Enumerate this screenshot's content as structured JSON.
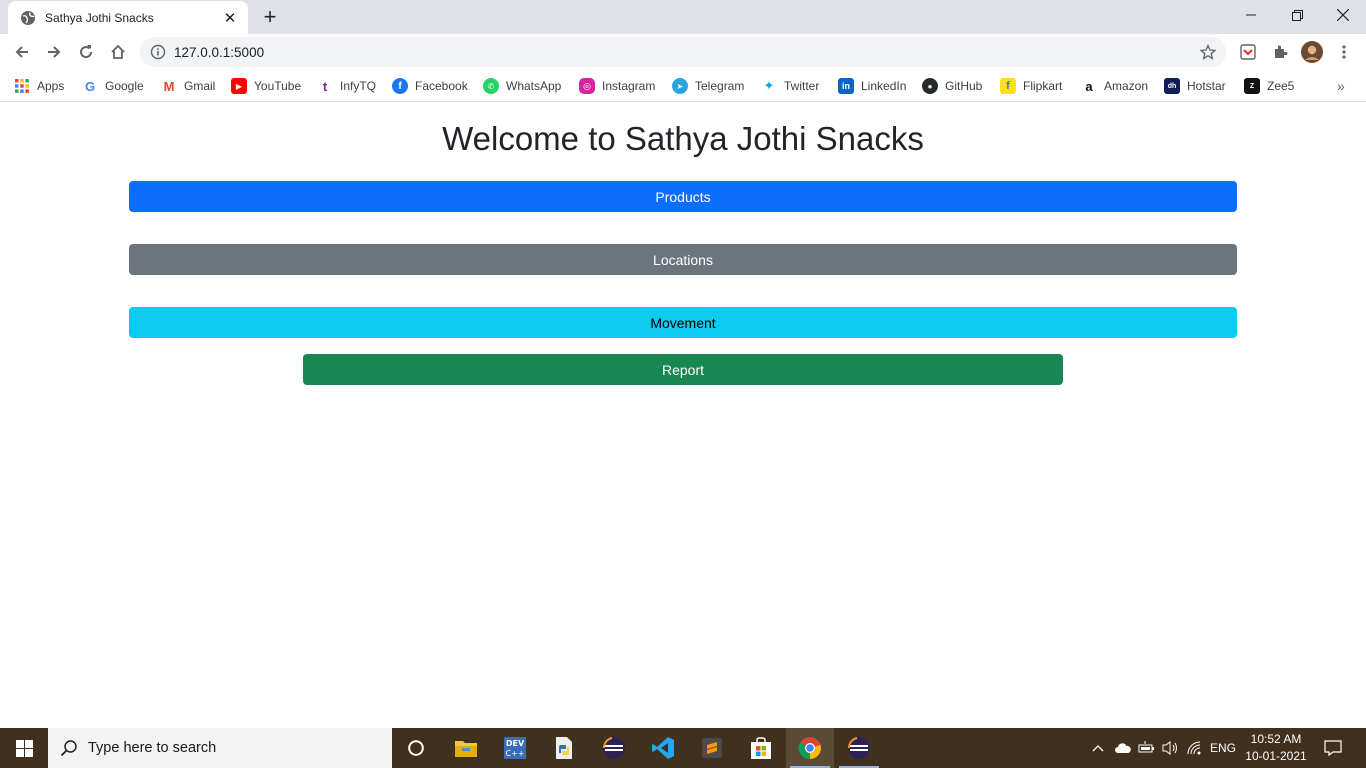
{
  "browser": {
    "tab_title": "Sathya Jothi Snacks",
    "url": "127.0.0.1:5000"
  },
  "bookmarks": [
    {
      "label": "Apps",
      "icon": "apps-grid-icon"
    },
    {
      "label": "Google",
      "icon": "google-icon"
    },
    {
      "label": "Gmail",
      "icon": "gmail-icon"
    },
    {
      "label": "YouTube",
      "icon": "youtube-icon"
    },
    {
      "label": "InfyTQ",
      "icon": "infytq-icon"
    },
    {
      "label": "Facebook",
      "icon": "facebook-icon"
    },
    {
      "label": "WhatsApp",
      "icon": "whatsapp-icon"
    },
    {
      "label": "Instagram",
      "icon": "instagram-icon"
    },
    {
      "label": "Telegram",
      "icon": "telegram-icon"
    },
    {
      "label": "Twitter",
      "icon": "twitter-icon"
    },
    {
      "label": "LinkedIn",
      "icon": "linkedin-icon"
    },
    {
      "label": "GitHub",
      "icon": "github-icon"
    },
    {
      "label": "Flipkart",
      "icon": "flipkart-icon"
    },
    {
      "label": "Amazon",
      "icon": "amazon-icon"
    },
    {
      "label": "Hotstar",
      "icon": "hotstar-icon"
    },
    {
      "label": "Zee5",
      "icon": "zee5-icon"
    }
  ],
  "page": {
    "title": "Welcome to Sathya Jothi Snacks",
    "buttons": {
      "products": "Products",
      "locations": "Locations",
      "movement": "Movement",
      "report": "Report"
    }
  },
  "colors": {
    "primary": "#0d6efd",
    "secondary": "#6c757d",
    "info": "#0dcaf0",
    "success": "#198754"
  },
  "taskbar": {
    "search_placeholder": "Type here to search",
    "language": "ENG",
    "time": "10:52 AM",
    "date": "10-01-2021"
  }
}
